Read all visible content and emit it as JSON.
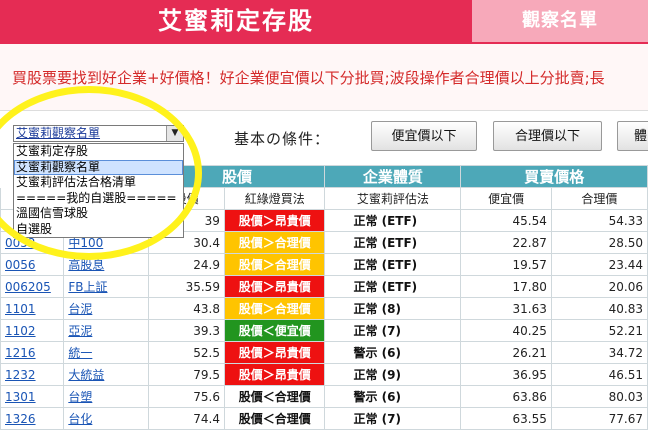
{
  "header": {
    "title": "艾蜜莉定存股",
    "tab_label": "觀察名單"
  },
  "banner_text": "買股票要找到好企業+好價格！好企業便宜價以下分批買;波段操作者合理價以上分批賣;長",
  "filter": {
    "select_value": "艾蜜莉觀察名單",
    "options": [
      "艾蜜莉定存股",
      "艾蜜莉觀察名單",
      "艾蜜莉評估法合格清單",
      "=====我的自選股=====",
      "溫國信雪球股",
      "自選股"
    ],
    "selected_index": 1,
    "condition_label": "基本の條件：",
    "buttons": [
      "便宜價以下",
      "合理價以下",
      "體"
    ]
  },
  "table": {
    "groups": [
      "股價",
      "企業體質",
      "買賣價格"
    ],
    "subheaders": [
      "股價",
      "紅綠燈買法",
      "艾蜜莉評估法",
      "便宜價",
      "合理價"
    ],
    "rows": [
      {
        "code": "",
        "name": "",
        "price": "39",
        "signal": "股價＞昂貴價",
        "color": "red",
        "eval": "正常 (ETF)",
        "cheap": "45.54",
        "fair": "54.33"
      },
      {
        "code": "0052",
        "name": "中100",
        "price": "30.4",
        "signal": "股價＞合理價",
        "color": "yel",
        "eval": "正常 (ETF)",
        "cheap": "22.87",
        "fair": "28.50"
      },
      {
        "code": "0056",
        "name": "高股息",
        "price": "24.9",
        "signal": "股價＞合理價",
        "color": "yel",
        "eval": "正常 (ETF)",
        "cheap": "19.57",
        "fair": "23.44"
      },
      {
        "code": "006205",
        "name": "FB上証",
        "price": "35.59",
        "signal": "股價＞昂貴價",
        "color": "red",
        "eval": "正常 (ETF)",
        "cheap": "17.80",
        "fair": "20.06"
      },
      {
        "code": "1101",
        "name": "台泥",
        "price": "43.8",
        "signal": "股價＞合理價",
        "color": "yel",
        "eval": "正常 (8)",
        "cheap": "31.63",
        "fair": "40.83"
      },
      {
        "code": "1102",
        "name": "亞泥",
        "price": "39.3",
        "signal": "股價＜便宜價",
        "color": "grn",
        "eval": "正常 (7)",
        "cheap": "40.25",
        "fair": "52.21"
      },
      {
        "code": "1216",
        "name": "統一",
        "price": "52.5",
        "signal": "股價＞昂貴價",
        "color": "red",
        "eval": "警示 (6)",
        "cheap": "26.21",
        "fair": "34.72"
      },
      {
        "code": "1232",
        "name": "大統益",
        "price": "79.5",
        "signal": "股價＞昂貴價",
        "color": "red",
        "eval": "正常 (9)",
        "cheap": "36.95",
        "fair": "46.51"
      },
      {
        "code": "1301",
        "name": "台塑",
        "price": "75.6",
        "signal": "股價＜合理價",
        "color": "wht",
        "eval": "警示 (6)",
        "cheap": "63.86",
        "fair": "80.03"
      },
      {
        "code": "1326",
        "name": "台化",
        "price": "74.4",
        "signal": "股價＜合理價",
        "color": "wht",
        "eval": "正常 (7)",
        "cheap": "63.55",
        "fair": "77.67"
      }
    ]
  },
  "colors": {
    "header_red": "#e52c54",
    "tab_pink": "#f7a9ba",
    "table_header": "#4da8b8",
    "highlight_circle": "#fff21c"
  }
}
